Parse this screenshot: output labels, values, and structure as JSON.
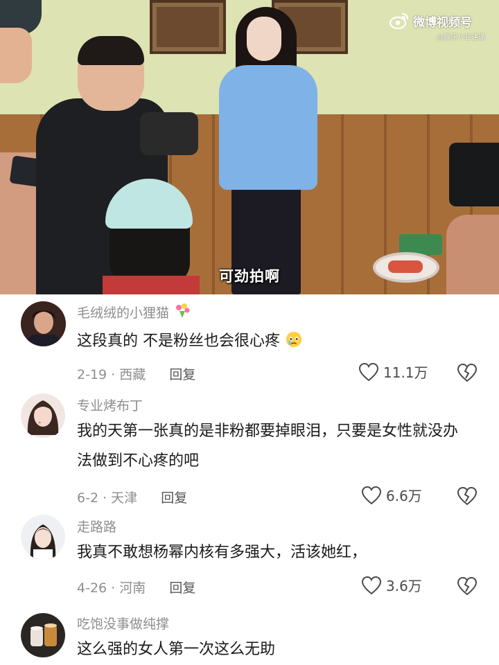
{
  "video": {
    "subtitle": "可劲拍啊",
    "watermark_brand": "微博视频号",
    "watermark_handle": "@娱乐八卦速递",
    "brand_color": "#ff4d4f"
  },
  "comments": [
    {
      "username": "毛绒绒的小狸猫",
      "text": "这段真的  不是粉丝也会很心疼",
      "date": "2-19",
      "location": "西藏",
      "reply_label": "回复",
      "likes": "11.1万",
      "username_icon": "bouquet-emoji",
      "text_icon": "teary-face-emoji"
    },
    {
      "username": "专业烤布丁",
      "text": "我的天第一张真的是非粉都要掉眼泪，只要是女性就没办法做到不心疼的吧",
      "date": "6-2",
      "location": "天津",
      "reply_label": "回复",
      "likes": "6.6万"
    },
    {
      "username": "走路路",
      "text": "我真不敢想杨幂内核有多强大，活该她红，",
      "date": "4-26",
      "location": "河南",
      "reply_label": "回复",
      "likes": "3.6万"
    },
    {
      "username": "吃饱没事做纯撑",
      "text": "这么强的女人第一次这么无助"
    }
  ]
}
